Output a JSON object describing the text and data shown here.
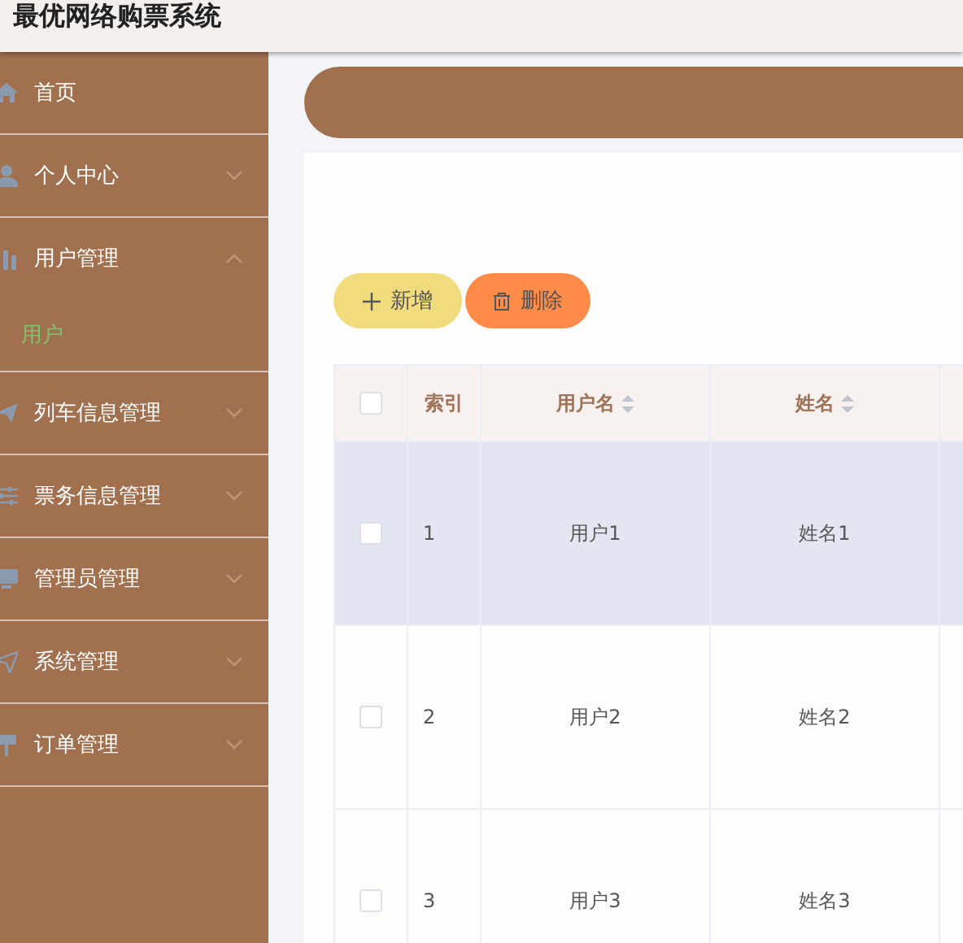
{
  "header": {
    "title": "最优网络购票系统"
  },
  "sidebar": {
    "items": [
      {
        "label": "首页"
      },
      {
        "label": "个人中心",
        "expanded": false
      },
      {
        "label": "用户管理",
        "expanded": true,
        "children": [
          {
            "label": "用户",
            "selected": true
          }
        ]
      },
      {
        "label": "列车信息管理",
        "expanded": false
      },
      {
        "label": "票务信息管理",
        "expanded": false
      },
      {
        "label": "管理员管理",
        "expanded": false
      },
      {
        "label": "系统管理",
        "expanded": false
      },
      {
        "label": "订单管理",
        "expanded": false
      }
    ]
  },
  "toolbar": {
    "buttons": [
      {
        "label": "新增",
        "kind": "add"
      },
      {
        "label": "删除",
        "kind": "delete"
      }
    ]
  },
  "table": {
    "select_all": {
      "checked": false
    },
    "columns": [
      {
        "label": "索引"
      },
      {
        "label": "用户名",
        "sortable": true
      },
      {
        "label": "姓名",
        "sortable": true
      }
    ],
    "rows": [
      {
        "checked": false,
        "hovered": true,
        "cells": [
          "1",
          "用户1",
          "姓名1"
        ]
      },
      {
        "checked": false,
        "hovered": false,
        "cells": [
          "2",
          "用户2",
          "姓名2"
        ]
      },
      {
        "checked": false,
        "hovered": false,
        "cells": [
          "3",
          "用户3",
          "姓名3"
        ]
      }
    ]
  }
}
